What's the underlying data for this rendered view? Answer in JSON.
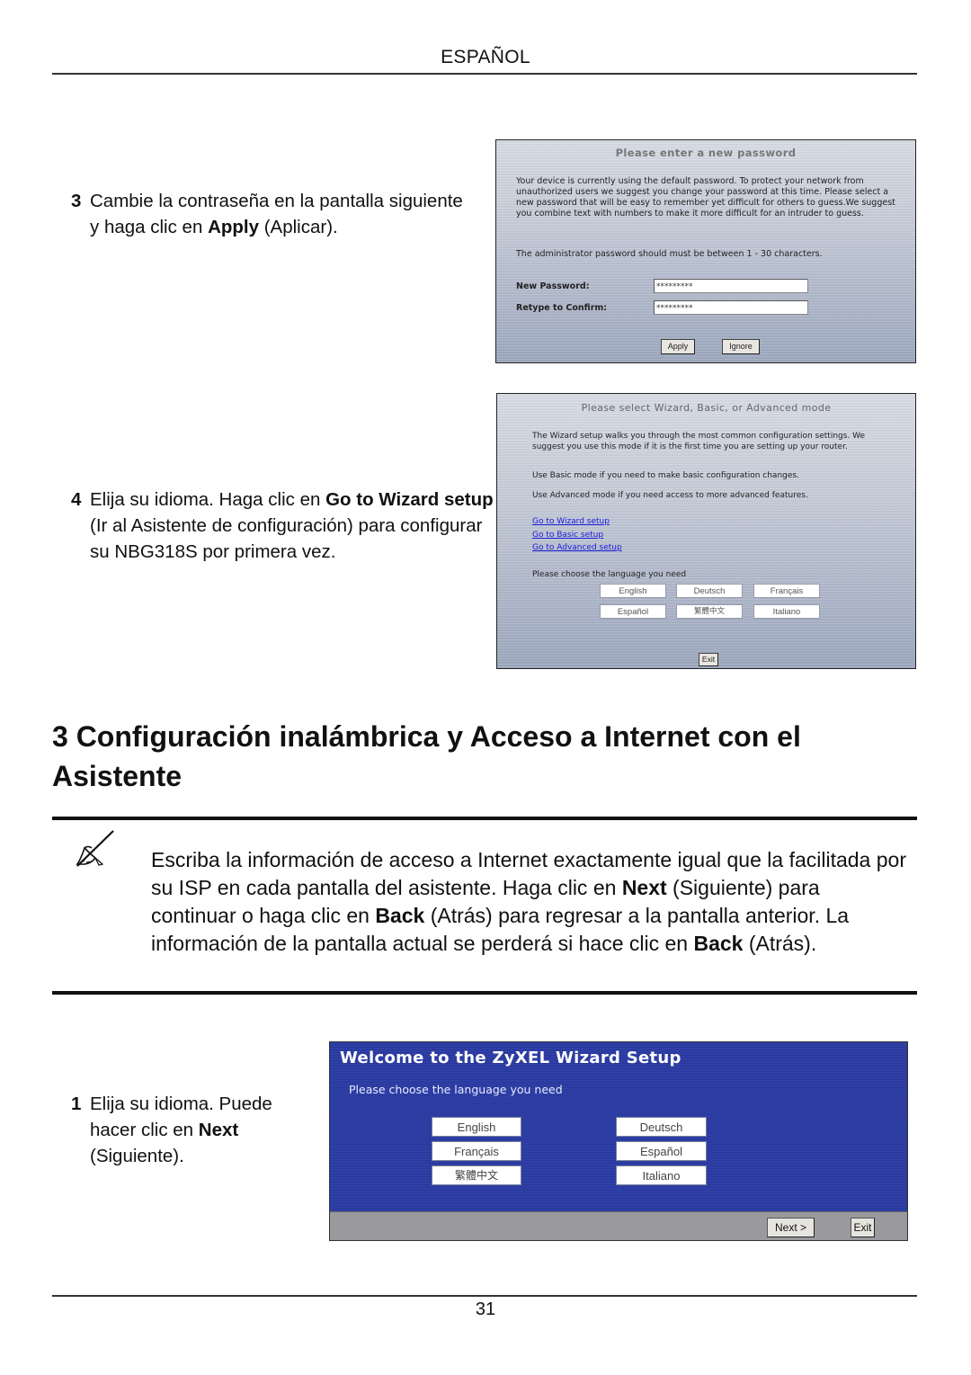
{
  "header": {
    "title": "ESPAÑOL"
  },
  "steps_top": [
    {
      "number": "3",
      "parts": [
        {
          "text": "Cambie la contraseña en la pantalla siguiente y haga clic en ",
          "bold": false
        },
        {
          "text": "Apply",
          "bold": true
        },
        {
          "text": " (Aplicar).",
          "bold": false
        }
      ]
    },
    {
      "number": "4",
      "parts": [
        {
          "text": "Elija su idioma. Haga clic en ",
          "bold": false
        },
        {
          "text": "Go to Wizard setup",
          "bold": true
        },
        {
          "text": " (Ir al Asistente de configuración) para configurar su NBG318S por primera vez.",
          "bold": false
        }
      ]
    }
  ],
  "password_screen": {
    "title": "Please enter a new password",
    "intro": "Your device is currently using the default password. To protect your network from unauthorized users we suggest you change your password at this time. Please select a new password that will be easy to remember yet difficult for others to guess.We suggest you combine text with numbers to make it more difficult for an intruder to guess.",
    "rule": "The administrator password should must be between 1 - 30 characters.",
    "new_password_label": "New Password:",
    "new_password_value": "*********",
    "confirm_label": "Retype to Confirm:",
    "confirm_value": "*********",
    "apply_label": "Apply",
    "ignore_label": "Ignore"
  },
  "mode_screen": {
    "title": "Please select Wizard, Basic, or Advanced mode",
    "p1": "The Wizard setup walks you through the most common configuration settings. We suggest you use this mode if it is the first time you are setting up your router.",
    "p2": "Use Basic mode if you need to make basic configuration changes.",
    "p3": "Use Advanced mode if you need access to more advanced features.",
    "links": [
      "Go to Wizard setup",
      "Go to Basic setup",
      "Go to Advanced setup"
    ],
    "language_prompt": "Please choose the language you need",
    "languages": [
      "English",
      "Deutsch",
      "Français",
      "Español",
      "繁體中文",
      "Italiano"
    ],
    "exit_label": "Exit"
  },
  "section": {
    "title": "3 Configuración inalámbrica y Acceso a Internet con el Asistente"
  },
  "note": {
    "icon": "pencil-note-icon",
    "parts": [
      {
        "text": "Escriba la información de acceso a Internet exactamente igual que la facilitada por su ISP en cada pantalla del asistente. Haga clic en ",
        "bold": false
      },
      {
        "text": "Next",
        "bold": true
      },
      {
        "text": " (Siguiente) para continuar o haga clic en ",
        "bold": false
      },
      {
        "text": "Back",
        "bold": true
      },
      {
        "text": " (Atrás) para regresar a la pantalla anterior. La información de la pantalla actual se perderá si hace clic en ",
        "bold": false
      },
      {
        "text": "Back",
        "bold": true
      },
      {
        "text": " (Atrás).",
        "bold": false
      }
    ]
  },
  "step_bottom": {
    "number": "1",
    "parts": [
      {
        "text": "Elija su idioma. Puede hacer clic en ",
        "bold": false
      },
      {
        "text": "Next",
        "bold": true
      },
      {
        "text": " (Siguiente).",
        "bold": false
      }
    ]
  },
  "wizard_screen": {
    "title": "Welcome to the ZyXEL Wizard Setup",
    "prompt": "Please choose the language you need",
    "languages_left": [
      "English",
      "Français",
      "繁體中文"
    ],
    "languages_right": [
      "Deutsch",
      "Español",
      "Italiano"
    ],
    "next_label": "Next >",
    "exit_label": "Exit",
    "colors": {
      "panel": "#2e3fa6",
      "footer": "#9a9a9e"
    }
  },
  "footer": {
    "page_number": "31"
  }
}
